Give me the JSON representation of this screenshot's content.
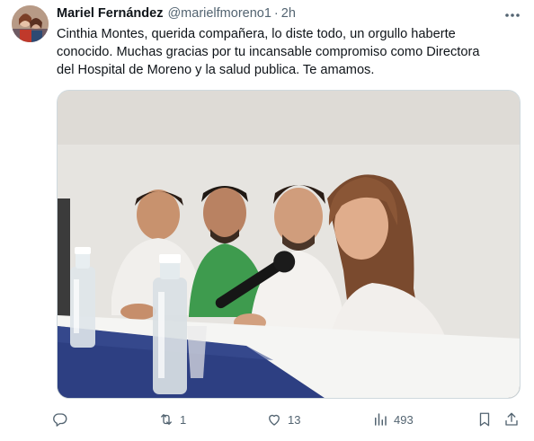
{
  "tweet": {
    "author": {
      "display_name": "Mariel Fernández",
      "handle": "@marielfmoreno1",
      "separator": "·",
      "time": "2h"
    },
    "body": "Cinthia Montes, querida compañera, lo diste todo, un orgullo haberte\nconocido. Muchas gracias por tu incansable compromiso como Directora\ndel Hospital de Moreno y la salud publica. Te amamos.",
    "media": {
      "type": "photo"
    },
    "actions": {
      "reply": {
        "icon": "reply-icon",
        "count": ""
      },
      "retweet": {
        "icon": "retweet-icon",
        "count": "1"
      },
      "like": {
        "icon": "heart-icon",
        "count": "13"
      },
      "views": {
        "icon": "views-icon",
        "count": "493"
      },
      "bookmark": {
        "icon": "bookmark-icon"
      },
      "share": {
        "icon": "share-icon"
      }
    },
    "more_icon": "more-icon"
  },
  "colors": {
    "text_primary": "#0f1419",
    "text_secondary": "#536471",
    "border": "#cfd9de"
  }
}
